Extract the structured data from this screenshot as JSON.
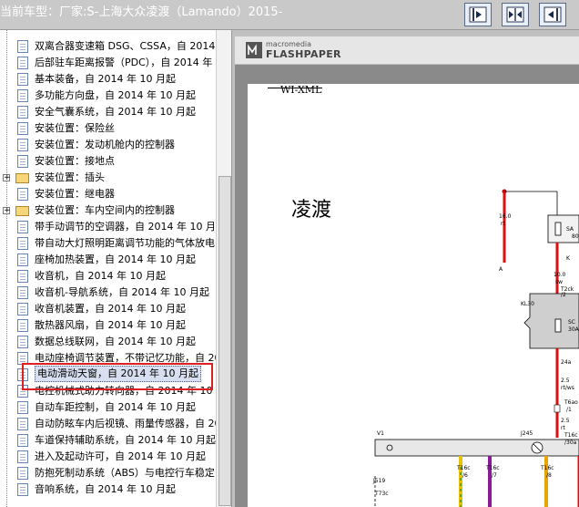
{
  "header": {
    "title": "当前车型：厂家:S-上海大众凌渡（Lamando）2015-",
    "buttons": [
      {
        "icon": "collapse-left-icon"
      },
      {
        "icon": "split-view-icon"
      },
      {
        "icon": "collapse-right-icon"
      }
    ]
  },
  "tree": {
    "items": [
      {
        "label": "双离合器变速箱 DSG、CSSA，自 2014 年",
        "type": "doc"
      },
      {
        "label": "后部驻车距离报警（PDC），自 2014 年",
        "type": "doc"
      },
      {
        "label": "基本装备，自 2014 年 10 月起",
        "type": "doc"
      },
      {
        "label": "多功能方向盘，自 2014 年 10 月起",
        "type": "doc"
      },
      {
        "label": "安全气囊系统，自 2014 年 10 月起",
        "type": "doc"
      },
      {
        "label": "安装位置：保险丝",
        "type": "doc"
      },
      {
        "label": "安装位置：发动机舱内的控制器",
        "type": "doc"
      },
      {
        "label": "安装位置：接地点",
        "type": "doc"
      },
      {
        "label": "安装位置：插头",
        "type": "folder"
      },
      {
        "label": "安装位置：继电器",
        "type": "doc"
      },
      {
        "label": "安装位置：车内空间内的控制器",
        "type": "folder"
      },
      {
        "label": "带手动调节的空调器，自 2014 年 10 月",
        "type": "doc"
      },
      {
        "label": "带自动大灯照明距离调节功能的气体放电",
        "type": "doc"
      },
      {
        "label": "座椅加热装置，自 2014 年 10 月起",
        "type": "doc"
      },
      {
        "label": "收音机，自 2014 年 10 月起",
        "type": "doc"
      },
      {
        "label": "收音机-导航系统，自 2014 年 10 月起",
        "type": "doc"
      },
      {
        "label": "收音机装置，自 2014 年 10 月起",
        "type": "doc"
      },
      {
        "label": "散热器风扇，自 2014 年 10 月起",
        "type": "doc"
      },
      {
        "label": "数据总线联网，自 2014 年 10 月起",
        "type": "doc"
      },
      {
        "label": "电动座椅调节装置，不带记忆功能，自 20",
        "type": "doc"
      },
      {
        "label": "电动滑动天窗，自 2014 年 10 月起",
        "type": "doc",
        "selected": true
      },
      {
        "label": "电控机械式助力转向器，自 2014 年 10",
        "type": "doc"
      },
      {
        "label": "自动车距控制，自 2014 年 10 月起",
        "type": "doc"
      },
      {
        "label": "自动防眩车内后视镜、雨量传感器，自 20",
        "type": "doc"
      },
      {
        "label": "车道保持辅助系统，自 2014 年 10 月起",
        "type": "doc"
      },
      {
        "label": "进入及起动许可，自 2014 年 10 月起",
        "type": "doc"
      },
      {
        "label": "防抱死制动系统（ABS）与电控行车稳定",
        "type": "doc"
      },
      {
        "label": "音响系统，自 2014 年 10 月起",
        "type": "doc"
      }
    ]
  },
  "viewer": {
    "brand_top": "macromedia",
    "brand_bottom": "FLASHPAPER",
    "doc_code": "WI-XML",
    "doc_title": "凌渡",
    "diagram_labels": [
      "16.0",
      "rt",
      "A",
      "SA",
      "80",
      "K",
      "10.0",
      "sw",
      "T2ck",
      "/2",
      "KL30",
      "SC",
      "30A",
      "24a",
      "2.5",
      "rt/ws",
      "T6ao",
      "/1",
      "2.5",
      "rt",
      "T16c",
      "/30a",
      "V1",
      "J245",
      "J519",
      "T73c",
      "T16c",
      "/6",
      "T16c",
      "/7",
      "T16c",
      "/8"
    ]
  }
}
